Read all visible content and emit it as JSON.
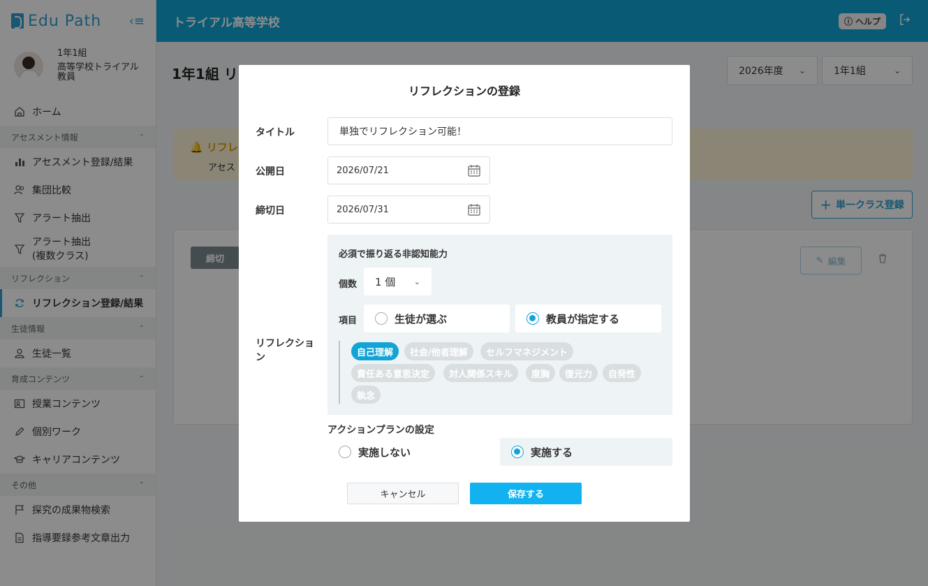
{
  "app": {
    "logo": "Edu Path",
    "school_name": "トライアル高等学校",
    "help_label": "ヘルプ"
  },
  "profile": {
    "class": "1年1組",
    "school": "高等学校トライアル",
    "role": "教員"
  },
  "sidebar": {
    "home": "ホーム",
    "sections": [
      {
        "title": "アセスメント情報",
        "items": [
          "アセスメント登録/結果",
          "集団比較",
          "アラート抽出",
          "アラート抽出\n(複数クラス)"
        ]
      },
      {
        "title": "リフレクション",
        "items": [
          "リフレクション登録/結果"
        ]
      },
      {
        "title": "生徒情報",
        "items": [
          "生徒一覧"
        ]
      },
      {
        "title": "育成コンテンツ",
        "items": [
          "授業コンテンツ",
          "個別ワーク",
          "キャリアコンテンツ"
        ]
      },
      {
        "title": "その他",
        "items": [
          "探究の成果物検索",
          "指導要録参考文章出力"
        ]
      }
    ]
  },
  "main": {
    "page_title": "1年1組 リフ",
    "year_select": "2026年度",
    "class_select": "1年1組",
    "notice_title": "リフレ",
    "notice_text": "アセス",
    "single_class_button": "単一クラス登録",
    "closed_badge": "締切",
    "edit_button": "編集"
  },
  "modal": {
    "title": "リフレクションの登録",
    "title_label": "タイトル",
    "title_value": "単独でリフレクション可能！",
    "publish_label": "公開日",
    "publish_value": "2026/07/21",
    "deadline_label": "締切日",
    "deadline_value": "2026/07/31",
    "reflection_label": "リフレクション",
    "required_title": "必須で振り返る非認知能力",
    "count_label": "個数",
    "count_value": "1 個",
    "item_label": "項目",
    "option_student": "生徒が選ぶ",
    "option_teacher": "教員が指定する",
    "selected_option": "教員が指定する",
    "skills": [
      "自己理解",
      "社会/他者理解",
      "セルフマネジメント",
      "責任ある意思決定",
      "対人関係スキル",
      "度胸",
      "復元力",
      "自発性",
      "執念"
    ],
    "selected_skill": "自己理解",
    "action_plan_label": "アクションプランの設定",
    "ap_no": "実施しない",
    "ap_yes": "実施する",
    "ap_selected": "実施する",
    "cancel": "キャンセル",
    "save": "保存する"
  },
  "colors": {
    "header": "#12a4d6",
    "accent": "#12b2f0",
    "logo": "#2f9fd0"
  }
}
